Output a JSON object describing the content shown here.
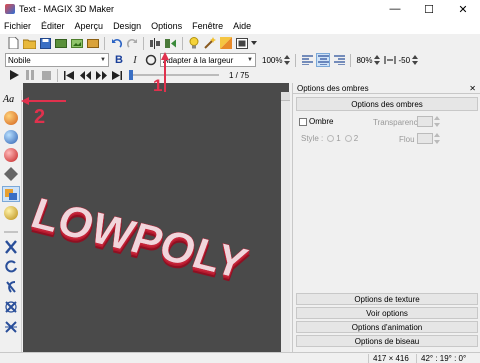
{
  "window": {
    "title": "Text - MAGIX 3D Maker",
    "minimize_glyph": "—",
    "maximize_glyph": "☐",
    "close_glyph": "✕"
  },
  "menu": [
    "Fichier",
    "Éditer",
    "Aperçu",
    "Design",
    "Options",
    "Fenêtre",
    "Aide"
  ],
  "toolbar2": {
    "font_name": "Nobile",
    "bold": "B",
    "italic": "I",
    "fit_mode": "Adapter à la largeur",
    "zoom": "100%",
    "percent": "80%",
    "value": "-50"
  },
  "toolbar3": {
    "frame_counter": "1 / 75"
  },
  "canvas": {
    "text": "LOWPOLY"
  },
  "annotations": {
    "marker1": "1",
    "marker2": "2"
  },
  "sidebar": {
    "top_label": "Aa"
  },
  "panel": {
    "header": "Options des ombres",
    "close_glyph": "✕",
    "section_title": "Options des ombres",
    "shadow_label": "Ombre",
    "transparency_label": "Transparence",
    "style_label": "Style :",
    "style_opt1": "1",
    "style_opt2": "2",
    "blur_label": "Flou",
    "bottom_buttons": [
      "Options de texture",
      "Voir options",
      "Options d'animation",
      "Options de biseau"
    ]
  },
  "status": {
    "size": "417 × 416",
    "angles": "42° : 19° : 0°"
  },
  "colors": {
    "canvas_bg": "#4a4a4a",
    "text_face": "#f1d6dc",
    "text_side": "#b51a2e",
    "arrow_red": "#e0314d",
    "selected_tool": "#cfe3f7"
  }
}
